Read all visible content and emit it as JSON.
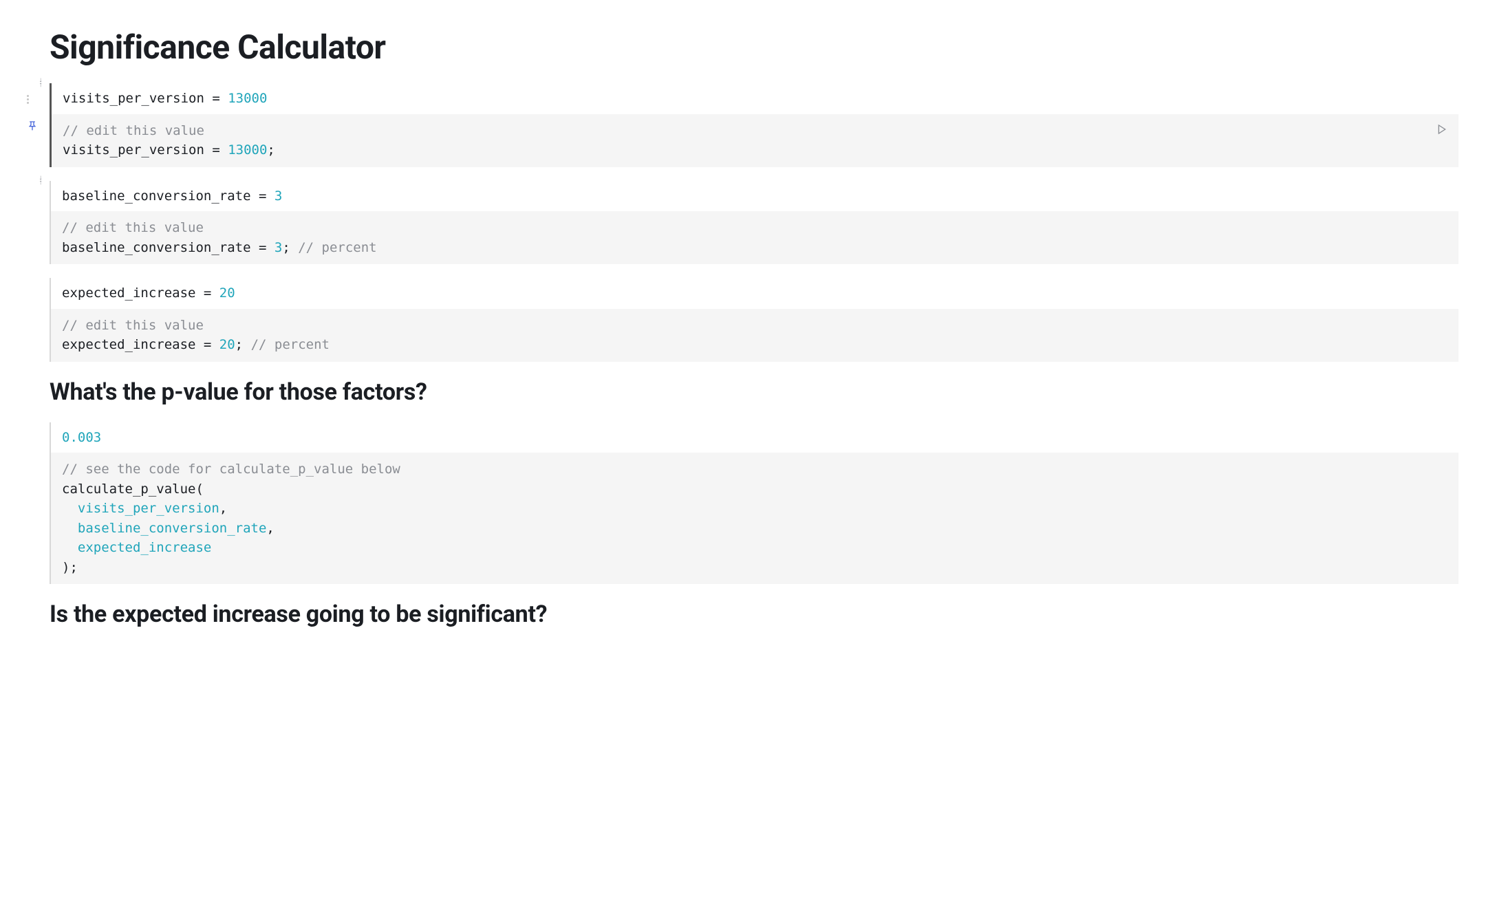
{
  "title": "Significance Calculator",
  "heading_pvalue": "What's the p-value for those factors?",
  "heading_significant": "Is the expected increase going to be significant?",
  "cells": {
    "visits": {
      "output_var": "visits_per_version = ",
      "output_val": "13000",
      "src_comment": "// edit this value",
      "src_code_var": "visits_per_version = ",
      "src_code_val": "13000",
      "src_code_tail": ";"
    },
    "baseline": {
      "output_var": "baseline_conversion_rate = ",
      "output_val": "3",
      "src_comment": "// edit this value",
      "src_code_var": "baseline_conversion_rate = ",
      "src_code_val": "3",
      "src_code_tail": "; ",
      "src_code_trailing_comment": "// percent"
    },
    "expected": {
      "output_var": "expected_increase = ",
      "output_val": "20",
      "src_comment": "// edit this value",
      "src_code_var": "expected_increase = ",
      "src_code_val": "20",
      "src_code_tail": "; ",
      "src_code_trailing_comment": "// percent"
    },
    "pvalue": {
      "output_val": "0.003",
      "src_comment": "// see the code for calculate_p_value below",
      "src_fn": "calculate_p_value",
      "src_open": "(",
      "src_arg1": "  visits_per_version",
      "src_comma": ",",
      "src_arg2": "  baseline_conversion_rate",
      "src_arg3": "  expected_increase",
      "src_close": ");"
    }
  }
}
